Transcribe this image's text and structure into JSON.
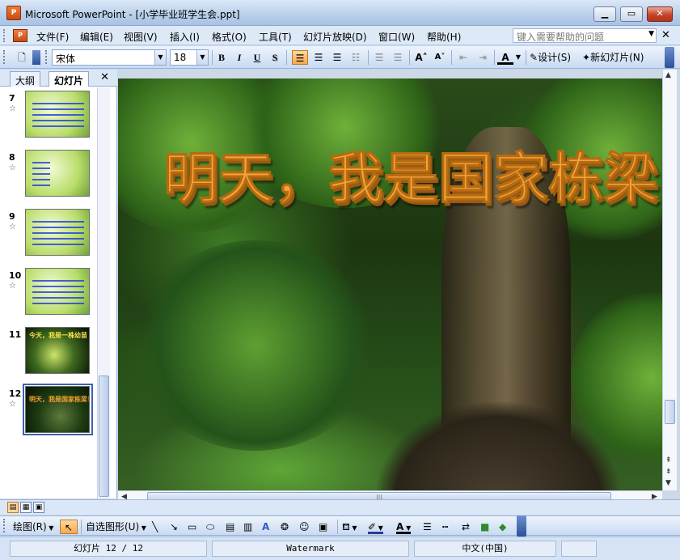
{
  "window": {
    "title": "Microsoft PowerPoint - [小学毕业班学生会.ppt]",
    "app_icon": "powerpoint-icon",
    "controls": [
      "minimize-icon",
      "maximize-icon",
      "close-icon"
    ]
  },
  "menu": {
    "items": [
      "文件(F)",
      "编辑(E)",
      "视图(V)",
      "插入(I)",
      "格式(O)",
      "工具(T)",
      "幻灯片放映(D)",
      "窗口(W)",
      "帮助(H)"
    ],
    "help_placeholder": "键入需要帮助的问题"
  },
  "toolbar": {
    "font_name": "宋体",
    "font_size": "18",
    "bold": "B",
    "italic": "I",
    "underline": "U",
    "shadow": "S",
    "design_label": "设计(S)",
    "new_slide_label": "新幻灯片(N)"
  },
  "panel": {
    "tabs": [
      "大纲",
      "幻灯片"
    ],
    "active_tab": "幻灯片",
    "slides": [
      {
        "number": "7"
      },
      {
        "number": "8"
      },
      {
        "number": "9"
      },
      {
        "number": "10"
      },
      {
        "number": "11",
        "caption": "今天，我是一株幼苗"
      },
      {
        "number": "12",
        "caption": "明天，我是国家栋梁！",
        "selected": true
      }
    ]
  },
  "slide": {
    "title": "明天，我是国家栋梁！"
  },
  "drawbar": {
    "draw_label": "绘图(R)",
    "autoshapes_label": "自选图形(U)"
  },
  "status": {
    "slide_counter": "幻灯片 12 / 12",
    "design_name": "Watermark",
    "language": "中文(中国)"
  },
  "colors": {
    "title_fill": "#f5a23a",
    "selection": "#3a64ad",
    "chrome": "#c6d9f0"
  }
}
